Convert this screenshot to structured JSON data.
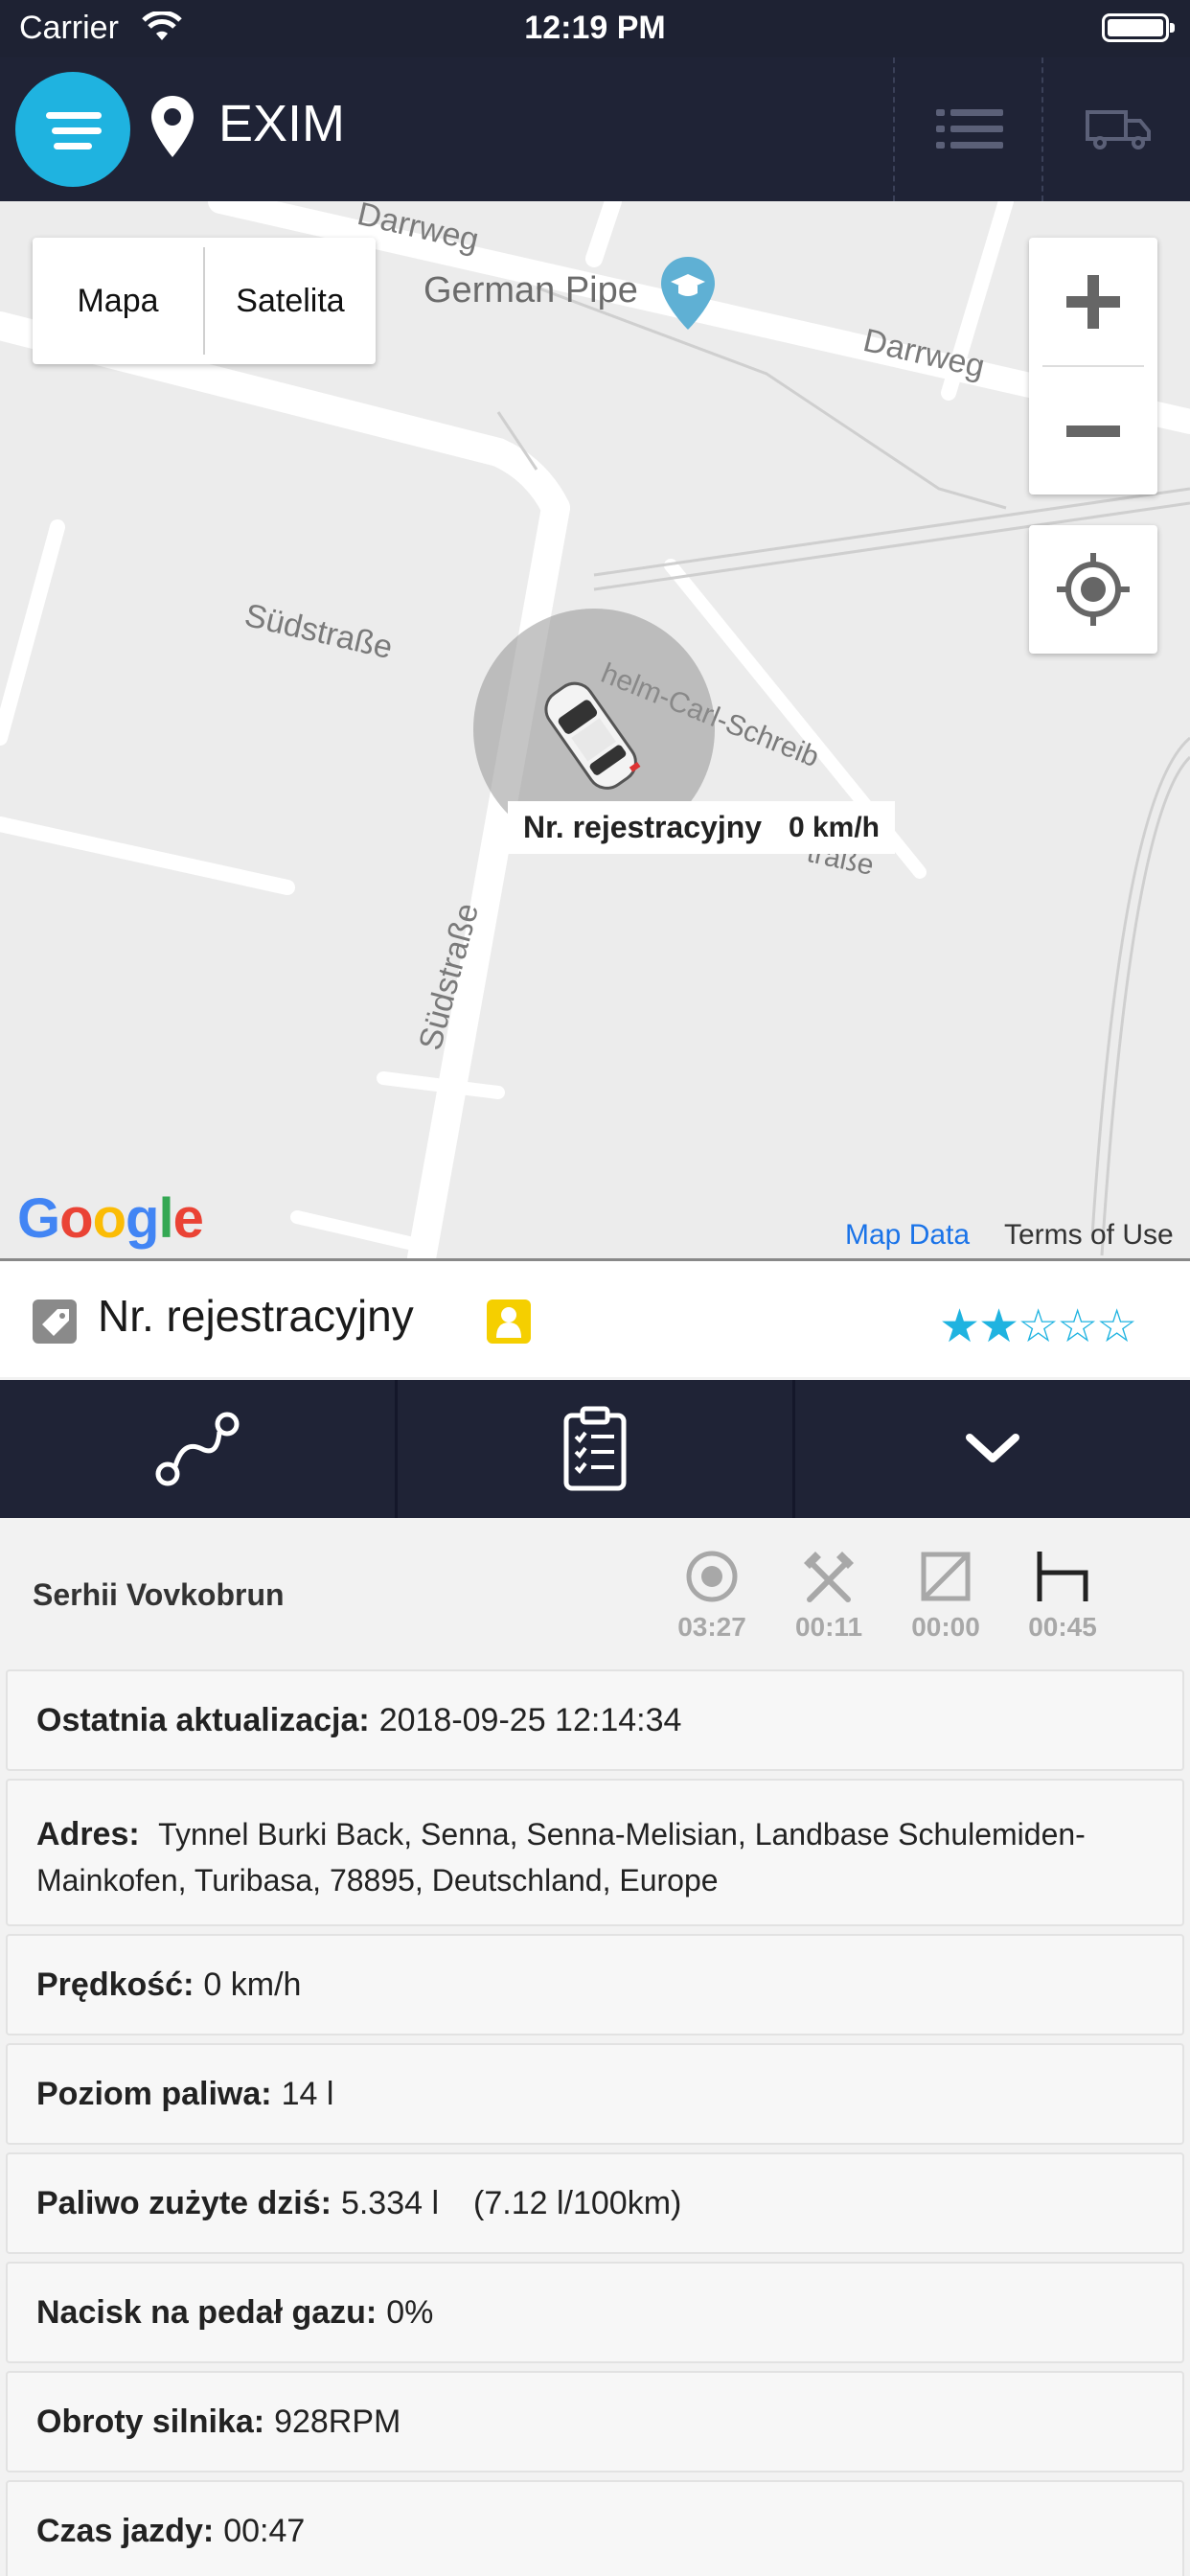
{
  "status_bar": {
    "carrier": "Carrier",
    "time": "12:19 PM"
  },
  "header": {
    "title": "EXIM"
  },
  "map": {
    "type_options": [
      "Mapa",
      "Satelita"
    ],
    "poi": "German Pipe",
    "roads": {
      "darrweg_1": "Darrweg",
      "darrweg_2": "Darrweg",
      "sudstrasse_1": "Südstraße",
      "sudstrasse_2": "Südstraße",
      "wilhelm": "helm-Carl-Schreib",
      "strasse": "traße"
    },
    "marker": {
      "label": "Nr. rejestracyjny",
      "speed": "0 km/h"
    },
    "attribution_logo": "Google",
    "map_data": "Map Data",
    "terms": "Terms of Use"
  },
  "vehicle": {
    "name": "Nr. rejestracyjny",
    "rating": 2,
    "rating_max": 5
  },
  "driver": {
    "name": "Serhii Vovkobrun",
    "stats": [
      {
        "icon": "target-icon",
        "value": "03:27"
      },
      {
        "icon": "tools-icon",
        "value": "00:11"
      },
      {
        "icon": "box-slash-icon",
        "value": "00:00"
      },
      {
        "icon": "bed-icon",
        "value": "00:45"
      }
    ]
  },
  "info": {
    "last_update": {
      "label": "Ostatnia aktualizacja:",
      "value": "2018-09-25 12:14:34"
    },
    "address": {
      "label": "Adres:",
      "value": "Tynnel Burki Back, Senna, Senna-Melisian, Landbase Schulemiden-Mainkofen, Turibasa, 78895, Deutschland, Europe"
    },
    "speed": {
      "label": "Prędkość:",
      "value": "0 km/h"
    },
    "fuel_level": {
      "label": "Poziom paliwa:",
      "value": "14 l"
    },
    "fuel_today": {
      "label": "Paliwo zużyte dziś:",
      "value": "5.334 l",
      "extra": "(7.12 l/100km)"
    },
    "pedal": {
      "label": "Nacisk na pedał gazu:",
      "value": "0%"
    },
    "rpm": {
      "label": "Obroty silnika:",
      "value": "928RPM"
    },
    "drive_time": {
      "label": "Czas jazdy:",
      "value": "00:47"
    }
  }
}
